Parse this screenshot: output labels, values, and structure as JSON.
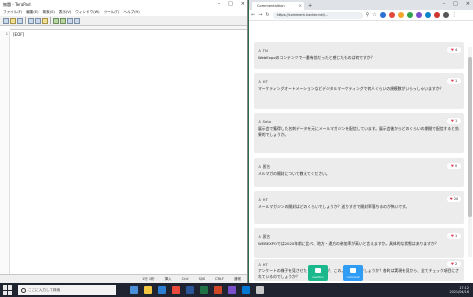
{
  "editor": {
    "title": "無題 - TeraPad",
    "menu": [
      "ファイル(F)",
      "編集(E)",
      "検索(S)",
      "表示(V)",
      "ウィンドウ(W)",
      "ツール(T)",
      "ヘルプ(H)"
    ],
    "line_number": "1",
    "text": "[EOF]",
    "status": [
      "1行 1桁",
      "挿入",
      "CrLf",
      "SJIS",
      "CRLF",
      "通常"
    ]
  },
  "browser": {
    "tab_title": "Commentaition",
    "url": "https://comment-hacker.net/..."
  },
  "comments": [
    {
      "name": "TN",
      "text": "WebExpoのコンテンツで一番有効だったと感じたものは何ですか？",
      "likes": "4"
    },
    {
      "name": "HT",
      "text": "マーケティングオートメーションなどデジタルマーケティングで何人くらいの規模数がいらっしゃいますか？",
      "likes": "1"
    },
    {
      "name": "Seto",
      "text": "展示会で獲得した名刺データを元にメールマガジンを配信しています。展示会後からどのくらいの期間で配信すると効果的でしょうか。",
      "likes": "1"
    },
    {
      "name": "匿名",
      "text": "メルマガの開封について教えてください。",
      "likes": "0"
    },
    {
      "name": "HT",
      "text": "メールマガジンの開封はどのくらいでしょうか？送りすぎで開封率落ちるのが怖いです。",
      "likes": "20"
    },
    {
      "name": "匿名",
      "text": "WEBEXPOでは2020年前に比べ、地方・遠方の参加率が高いと言えますか。具体的な状態はありますか？",
      "likes": "1"
    },
    {
      "name": "HT",
      "text": "アンケートの様子を見させたとの事ですが、このような内容でしょうか？各町は実現を見から、全てチェック項目にされているのでしょうか？",
      "likes": "2"
    }
  ],
  "footer": {
    "left_label": "reaction",
    "right_label": "comment"
  },
  "taskbar": {
    "search_placeholder": "ここに入力して検索",
    "time": "17:12",
    "date": "2021/04/16"
  }
}
